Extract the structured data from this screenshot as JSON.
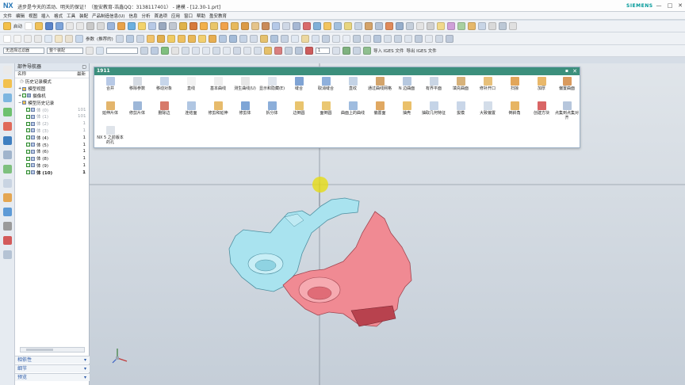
{
  "window": {
    "app_logo": "NX",
    "title": "进步是今天的活动、明天的保证！（盈安教育-浩鑫QQ：3138117401） - 建模 - [12.30-1.prt]",
    "brand": "SIEMENS",
    "controls": [
      "—",
      "□",
      "✕"
    ]
  },
  "menubar": {
    "items": [
      "文件",
      "编辑",
      "视图",
      "插入",
      "格式",
      "工具",
      "装配",
      "产品制造信息(U)",
      "信息",
      "分析",
      "首选项",
      "应用",
      "窗口",
      "帮助",
      "盈安教育"
    ]
  },
  "toolbar": {
    "start_label": "启动",
    "params_label": "参数",
    "params_sub": "(推荐的)",
    "filter_value": "无选择过滤器",
    "assembly_value": "整个装配",
    "import_iges": "导入 IGES 文件",
    "export_iges": "导出 IGES 文件",
    "page_value": "1"
  },
  "navigator": {
    "title": "部件导航器",
    "col_name": "名称",
    "col_date": "最新",
    "items": [
      {
        "label": "历史记录模式",
        "num": "",
        "style": ""
      },
      {
        "label": "模型视图",
        "num": "",
        "style": ""
      },
      {
        "label": "摄像机",
        "num": "",
        "style": ""
      },
      {
        "label": "模型历史记录",
        "num": "",
        "style": ""
      },
      {
        "label": "体 (0)",
        "num": "101",
        "style": "grey"
      },
      {
        "label": "体 (1)",
        "num": "101",
        "style": "grey"
      },
      {
        "label": "体 (2)",
        "num": "1",
        "style": "grey"
      },
      {
        "label": "体 (3)",
        "num": "1",
        "style": "grey"
      },
      {
        "label": "体 (4)",
        "num": "1",
        "style": ""
      },
      {
        "label": "体 (5)",
        "num": "1",
        "style": ""
      },
      {
        "label": "体 (6)",
        "num": "1",
        "style": ""
      },
      {
        "label": "体 (8)",
        "num": "1",
        "style": ""
      },
      {
        "label": "体 (9)",
        "num": "1",
        "style": ""
      },
      {
        "label": "体 (10)",
        "num": "1",
        "style": "bold"
      }
    ],
    "accordion": [
      "相依性",
      "细节",
      "预览"
    ]
  },
  "command_panel": {
    "title": "1911",
    "row1": [
      "合并",
      "移除参数",
      "移动对象",
      "直线",
      "基本曲线",
      "测生曲线(U)",
      "显示和隐藏(E)",
      "缝合",
      "取消缝合",
      "直纹",
      "通过曲线网格",
      "N 边曲面",
      "有界平面",
      "填充曲面",
      "修补开口",
      "扫掠",
      "加厚",
      "偏置曲面"
    ],
    "row2": [
      "延伸片体",
      "修剪片体",
      "删除边",
      "连结面",
      "修剪和延伸",
      "修剪体",
      "拆分体",
      "边倒圆",
      "面倒圆",
      "曲面上的曲线",
      "偏置面",
      "抽壳",
      "抽取几何特征",
      "拔模",
      "大致偏置",
      "倒斜角",
      "创建方块",
      "点集到点集对齐"
    ],
    "row3": [
      "NX 5 之前版本的孔"
    ]
  },
  "colors": {
    "cyan_body": "#a9e3ef",
    "red_body": "#f08a93",
    "accent": "#3c8f7c"
  }
}
